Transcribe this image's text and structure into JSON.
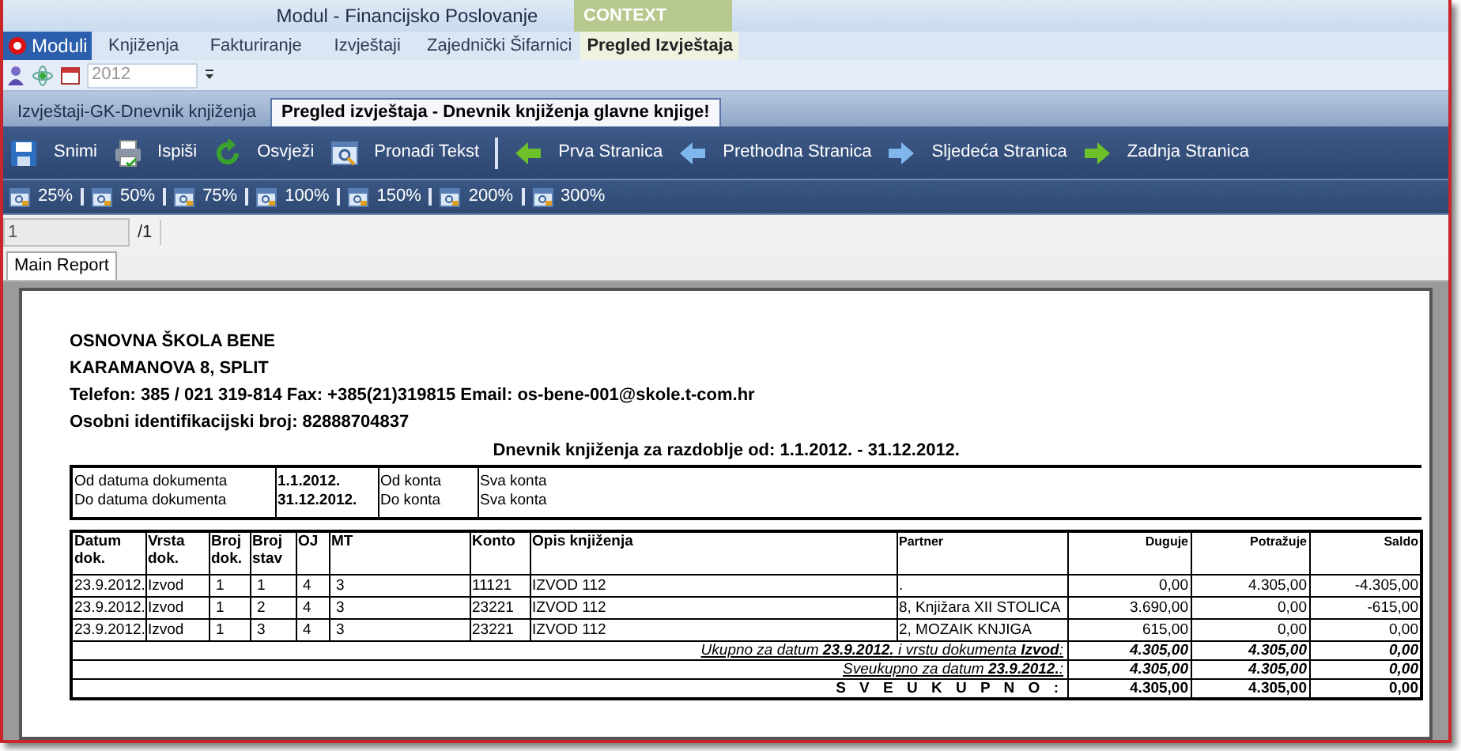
{
  "window": {
    "title": "Modul - Financijsko Poslovanje",
    "context_label": "CONTEXT"
  },
  "menu": {
    "app_button": "Moduli",
    "tabs": [
      {
        "label": "Knjiženja",
        "selected": false
      },
      {
        "label": "Fakturiranje",
        "selected": false
      },
      {
        "label": "Izvještaji",
        "selected": false
      },
      {
        "label": "Zajednički Šifarnici",
        "selected": false
      },
      {
        "label": "Pregled Izvještaja",
        "selected": true
      }
    ]
  },
  "quick_toolbar": {
    "year": "2012"
  },
  "doc_tabs": [
    {
      "label": "Izvještaji-GK-Dnevnik knjiženja",
      "selected": false
    },
    {
      "label": "Pregled izvještaja - Dnevnik knjiženja glavne knjige!",
      "selected": true
    }
  ],
  "toolbar": [
    {
      "label": "Snimi",
      "kind": "save"
    },
    {
      "label": "Ispiši",
      "kind": "print"
    },
    {
      "label": "Osvježi",
      "kind": "refresh"
    },
    {
      "label": "Pronađi Tekst",
      "kind": "find"
    },
    {
      "label": "Prva Stranica",
      "kind": "first"
    },
    {
      "label": "Prethodna Stranica",
      "kind": "prev"
    },
    {
      "label": "Sljedeća Stranica",
      "kind": "next"
    },
    {
      "label": "Zadnja Stranica",
      "kind": "last"
    }
  ],
  "zoom_buttons": [
    "25%",
    "50%",
    "75%",
    "100%",
    "150%",
    "200%",
    "300%"
  ],
  "pager": {
    "page": "1",
    "total": "/1"
  },
  "report_tabs": [
    {
      "label": "Main Report",
      "selected": true
    }
  ],
  "report": {
    "header_lines": [
      "OSNOVNA ŠKOLA BENE",
      "KARAMANOVA 8, SPLIT",
      "Telefon: 385 / 021 319-814 Fax: +385(21)319815 Email: os-bene-001@skole.t-com.hr",
      "Osobni identifikacijski broj: 82888704837"
    ],
    "title": "Dnevnik knjiženja za razdoblje od: 1.1.2012. - 31.12.2012.",
    "filters": [
      [
        "Od datuma dokumenta",
        "1.1.2012.",
        "Od konta",
        "Sva konta"
      ],
      [
        "Do datuma dokumenta",
        "31.12.2012.",
        "Do konta",
        "Sva konta"
      ]
    ],
    "columns": [
      "Datum dok.",
      "Vrsta dok.",
      "Broj dok.",
      "Broj stav",
      "OJ",
      "MT",
      "Konto",
      "Opis knjiženja",
      "Partner",
      "Duguje",
      "Potražuje",
      "Saldo"
    ],
    "rows": [
      [
        "23.9.2012.",
        "Izvod",
        "1",
        "1",
        "4",
        "3",
        "11121",
        "IZVOD 112",
        ".",
        "0,00",
        "4.305,00",
        "-4.305,00"
      ],
      [
        "23.9.2012.",
        "Izvod",
        "1",
        "2",
        "4",
        "3",
        "23221",
        "IZVOD 112",
        "8, Knjižara XII STOLICA",
        "3.690,00",
        "0,00",
        "-615,00"
      ],
      [
        "23.9.2012.",
        "Izvod",
        "1",
        "3",
        "4",
        "3",
        "23221",
        "IZVOD 112",
        "2, MOZAIK KNJIGA",
        "615,00",
        "0,00",
        "0,00"
      ]
    ],
    "summaries": [
      {
        "kind": "subtotal",
        "label": "Ukupno za datum  **23.9.2012.** i vrstu dokumenta  **Izvod**:",
        "values": [
          "4.305,00",
          "4.305,00",
          "0,00"
        ]
      },
      {
        "kind": "subtotal",
        "label": "Sveukupno za datum  **23.9.2012.**:",
        "values": [
          "4.305,00",
          "4.305,00",
          "0,00"
        ]
      },
      {
        "kind": "total",
        "label": "S V E U K U P N O :",
        "values": [
          "4.305,00",
          "4.305,00",
          "0,00"
        ]
      }
    ]
  }
}
